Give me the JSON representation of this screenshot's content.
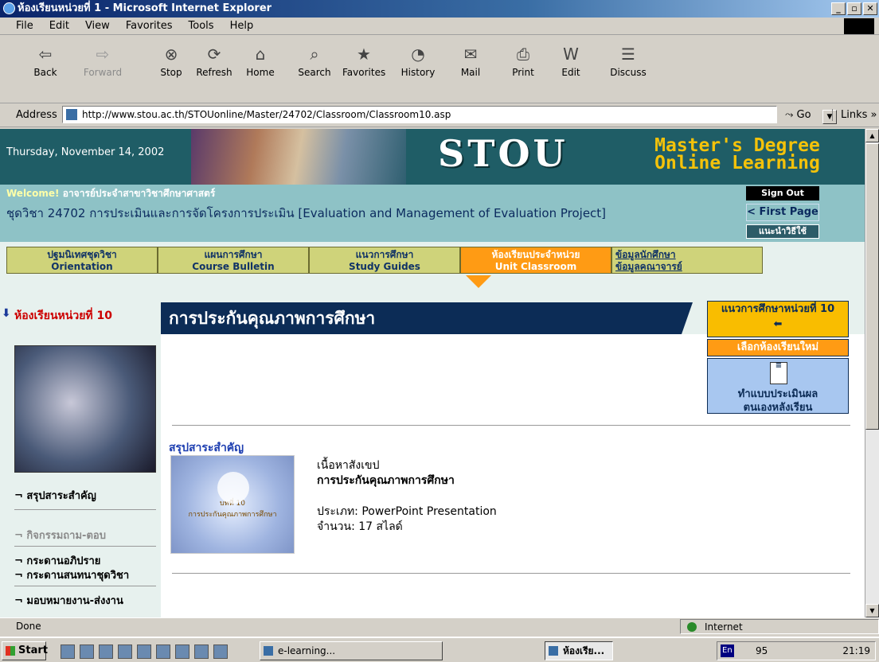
{
  "window": {
    "title": "ห้องเรียนหน่วยที่ 1 - Microsoft Internet Explorer"
  },
  "menu": [
    "File",
    "Edit",
    "View",
    "Favorites",
    "Tools",
    "Help"
  ],
  "toolbar": {
    "back": "Back",
    "forward": "Forward",
    "stop": "Stop",
    "refresh": "Refresh",
    "home": "Home",
    "search": "Search",
    "favorites": "Favorites",
    "history": "History",
    "mail": "Mail",
    "print": "Print",
    "edit": "Edit",
    "discuss": "Discuss"
  },
  "address": {
    "label": "Address",
    "url": "http://www.stou.ac.th/STOUonline/Master/24702/Classroom/Classroom10.asp",
    "go": "Go",
    "links": "Links"
  },
  "header": {
    "date": "Thursday, November 14, 2002",
    "logo": "STOU",
    "tagline1": "Master's Degree",
    "tagline2": "Online Learning"
  },
  "welcome": {
    "welcome": "Welcome!",
    "name": "อาจารย์ประจำสาขาวิชาศึกษาศาสตร์",
    "course": "ชุดวิชา 24702 การประเมินและการจัดโครงการประเมิน [Evaluation and Management of Evaluation Project]",
    "signout": "Sign Out",
    "firstpage": "< First Page",
    "howto": "แนะนำวิธีใช้"
  },
  "nav": [
    {
      "th": "ปฐมนิเทศชุดวิชา",
      "en": "Orientation"
    },
    {
      "th": "แผนการศึกษา",
      "en": "Course Bulletin"
    },
    {
      "th": "แนวการศึกษา",
      "en": "Study Guides"
    },
    {
      "th": "ห้องเรียนประจำหน่วย",
      "en": "Unit Classroom"
    },
    {
      "th": "ข้อมูลนักศึกษา",
      "en": "ข้อมูลคณาจารย์"
    }
  ],
  "left": {
    "unit": "ห้องเรียนหน่วยที่ 10",
    "summary": "¬ สรุปสาระสำคัญ",
    "qa": "¬ กิจกรรมถาม-ตอบ",
    "board1": "¬ กระดานอภิปราย",
    "board2": "¬ กระดานสนทนาชุดวิชา",
    "assign": "¬ มอบหมายงาน-ส่งงาน"
  },
  "main": {
    "title": "การประกันคุณภาพการศึกษา",
    "summ_heading": "สรุปสาระสำคัญ",
    "thumb_line1": "บทที่ 10",
    "thumb_line2": "การประกันคุณภาพการศึกษา",
    "info_label": "เนื้อหาสังเขป",
    "info_title": "การประกันคุณภาพการศึกษา",
    "info_type": "ประเภท: PowerPoint Presentation",
    "info_count": "จำนวน: 17 สไลด์"
  },
  "right": {
    "guide": "แนวการศึกษาหน่วยที่ 10",
    "choose": "เลือกห้องเรียนใหม่",
    "eval1": "ทำแบบประเมินผล",
    "eval2": "ตนเองหลังเรียน"
  },
  "status": {
    "left": "Done",
    "zone": "Internet"
  },
  "taskbar": {
    "start": "Start",
    "task1": "e-learning...",
    "task2": "ห้องเรีย...",
    "tray_num": "95",
    "clock": "21:19",
    "lang": "En"
  }
}
